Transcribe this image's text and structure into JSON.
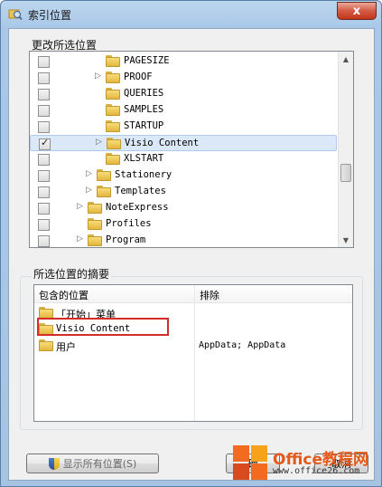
{
  "window": {
    "title": "索引位置",
    "close_label": "x"
  },
  "change_section": {
    "label": "更改所选位置"
  },
  "tree": {
    "items": [
      {
        "label": "PAGESIZE",
        "checked": false,
        "expandable": false,
        "indent": 2
      },
      {
        "label": "PROOF",
        "checked": false,
        "expandable": true,
        "indent": 2
      },
      {
        "label": "QUERIES",
        "checked": false,
        "expandable": false,
        "indent": 2
      },
      {
        "label": "SAMPLES",
        "checked": false,
        "expandable": false,
        "indent": 2
      },
      {
        "label": "STARTUP",
        "checked": false,
        "expandable": false,
        "indent": 2
      },
      {
        "label": "Visio Content",
        "checked": true,
        "expandable": true,
        "indent": 2,
        "selected": true
      },
      {
        "label": "XLSTART",
        "checked": false,
        "expandable": false,
        "indent": 2
      },
      {
        "label": "Stationery",
        "checked": false,
        "expandable": true,
        "indent": 1
      },
      {
        "label": "Templates",
        "checked": false,
        "expandable": true,
        "indent": 1
      },
      {
        "label": "NoteExpress",
        "checked": false,
        "expandable": true,
        "indent": 0
      },
      {
        "label": "Profiles",
        "checked": false,
        "expandable": false,
        "indent": 0
      },
      {
        "label": "Program",
        "checked": false,
        "expandable": true,
        "indent": 0
      }
    ]
  },
  "summary_section": {
    "label": "所选位置的摘要",
    "col_included": "包含的位置",
    "col_excluded": "排除",
    "rows": [
      {
        "name": "「开始」菜单",
        "exclude": ""
      },
      {
        "name": "Visio Content",
        "exclude": ""
      },
      {
        "name": "用户",
        "exclude": "AppData; AppData"
      }
    ]
  },
  "buttons": {
    "show_all": "显示所有位置(S)",
    "ok_partial": "确",
    "cancel_partial": "取消"
  },
  "watermark": {
    "title": "Office教程网",
    "url": "www.office26.com"
  },
  "colors": {
    "highlight": "#d62b2b",
    "watermark_accent": "#e45a1c"
  }
}
